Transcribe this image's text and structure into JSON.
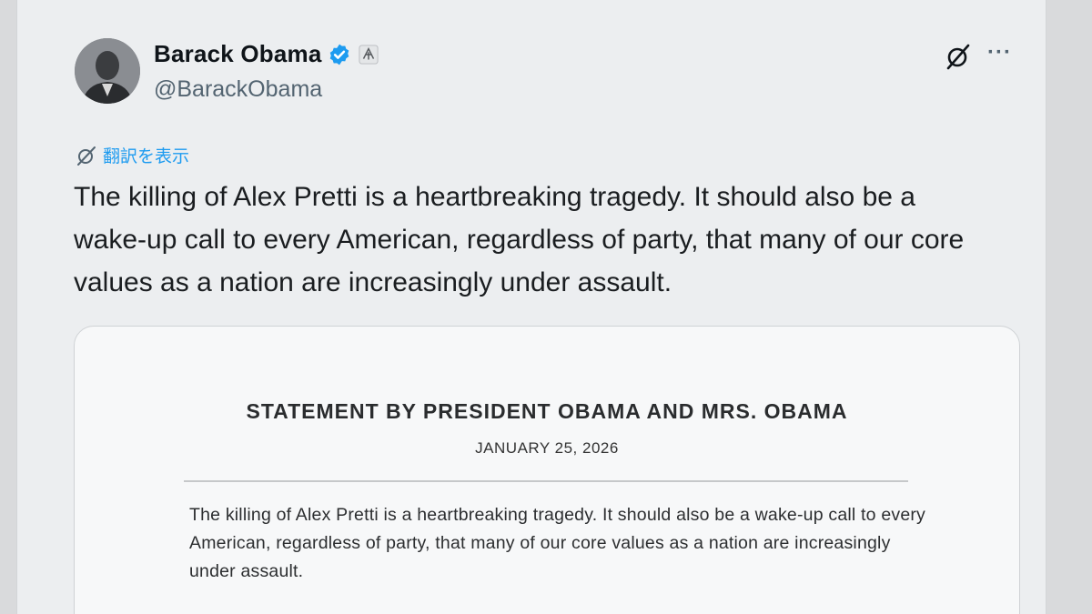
{
  "author": {
    "name": "Barack Obama",
    "handle": "@BarackObama"
  },
  "icons": {
    "verified": "verified-badge-icon",
    "affiliation": "affiliation-icon",
    "grok": "grok-icon",
    "more": "more-icon",
    "translate": "translate-icon"
  },
  "actions": {
    "more_label": "···",
    "translate_label": "翻訳を表示"
  },
  "tweet": {
    "text": "The killing of Alex Pretti is a heartbreaking tragedy. It should also be a wake-up call to every American, regardless of party, that many of our core values as a nation are increasingly under assault."
  },
  "statement": {
    "title": "STATEMENT BY PRESIDENT OBAMA AND MRS. OBAMA",
    "date": "JANUARY 25, 2026",
    "body": "The killing of Alex Pretti is a heartbreaking tragedy. It should also be a wake-up call to every American, regardless of party, that many of our core values as a nation are increasingly under assault."
  },
  "colors": {
    "verified_blue": "#1d9bf0",
    "secondary_text": "#536471",
    "card_background": "#f7f8f9"
  }
}
